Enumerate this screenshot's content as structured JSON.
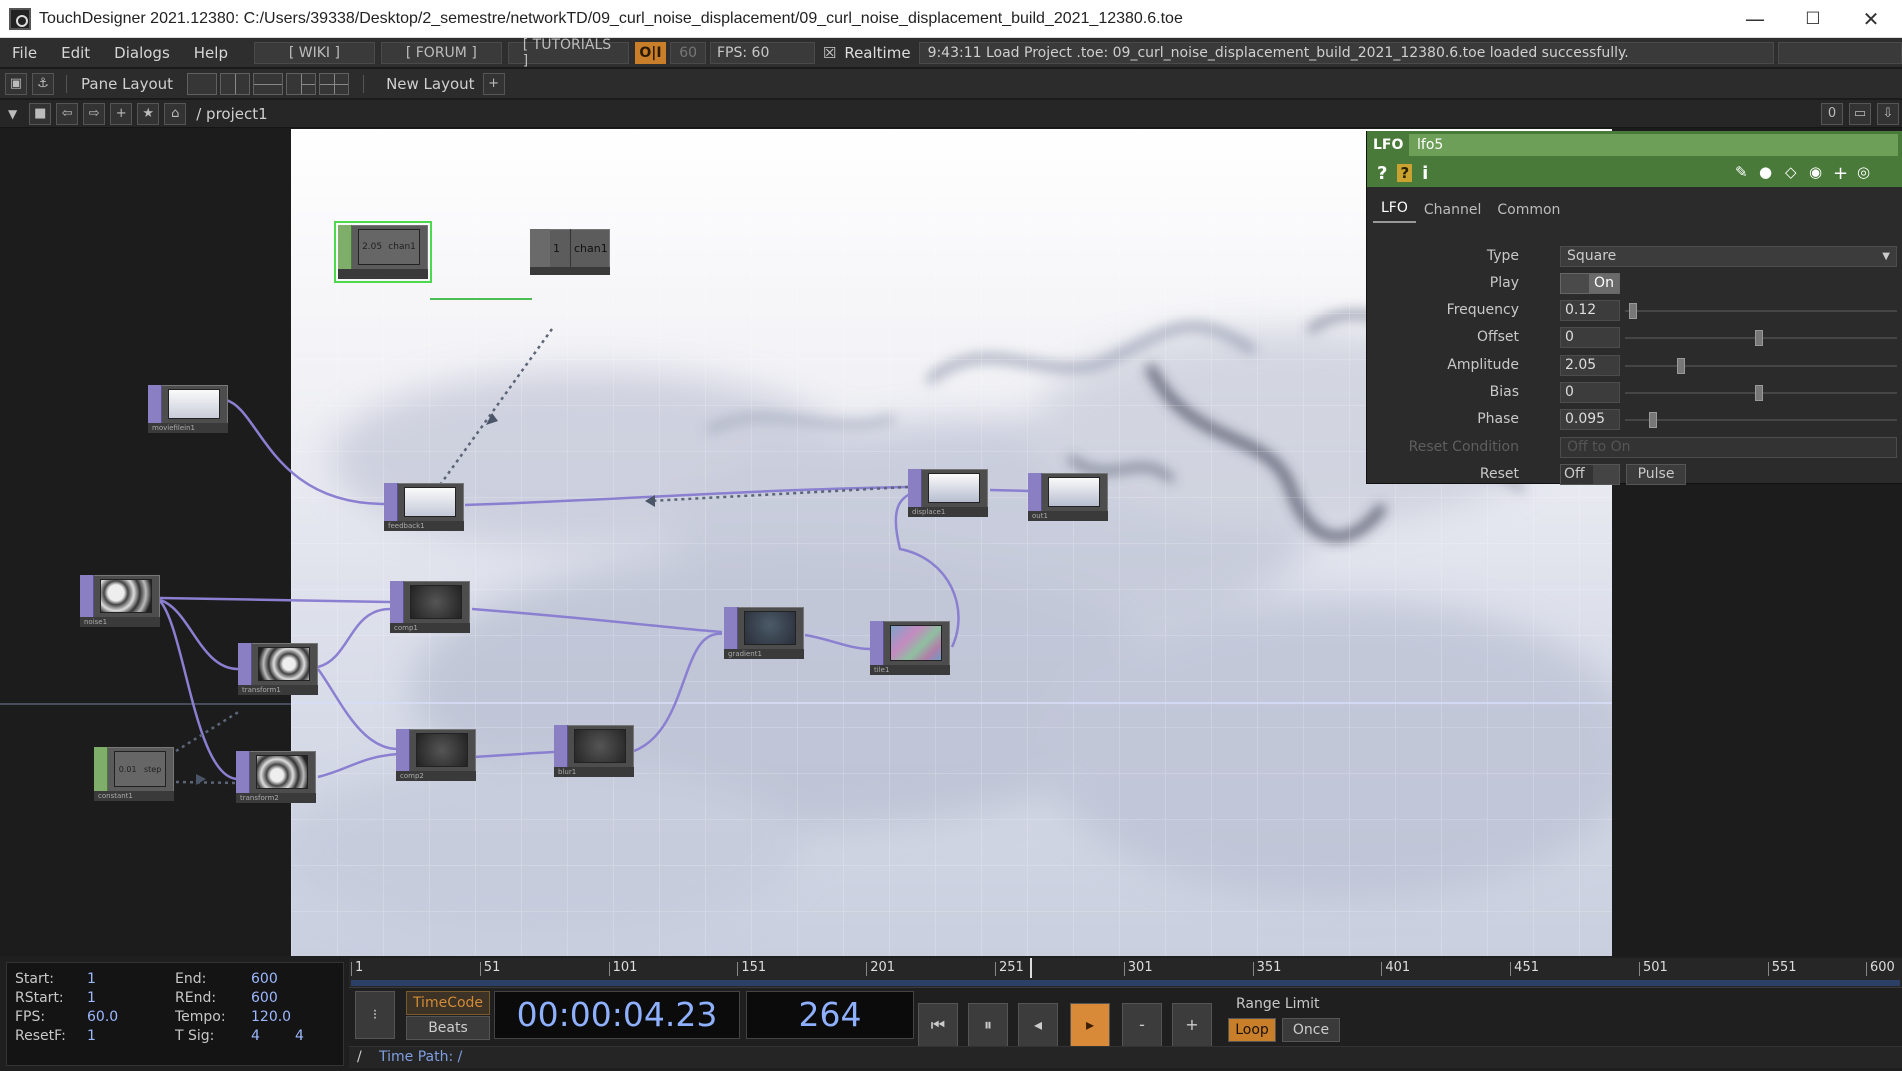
{
  "window": {
    "title": "TouchDesigner 2021.12380: C:/Users/39338/Desktop/2_semestre/networkTD/09_curl_noise_displacement/09_curl_noise_displacement_build_2021_12380.6.toe",
    "minimize": "—",
    "maximize": "☐",
    "close": "✕"
  },
  "menubar": {
    "file": "File",
    "edit": "Edit",
    "dialogs": "Dialogs",
    "help": "Help",
    "wiki": "[ WIKI ]",
    "forum": "[ FORUM ]",
    "tutorials": "[ TUTORIALS ]",
    "oi": "O|I",
    "fps_cap": "60",
    "fps_display": "FPS:  60",
    "realtime_check": "☒",
    "realtime": "Realtime",
    "status": "9:43:11 Load Project .toe: 09_curl_noise_displacement_build_2021_12380.6.toe loaded successfully."
  },
  "panebar": {
    "pane_layout": "Pane Layout",
    "new_layout": "New Layout",
    "add": "+"
  },
  "pathbar": {
    "path": "/ project1",
    "counter": "0"
  },
  "nodes": {
    "lfo_value": "2.05",
    "lfo_channel": "chan1",
    "null_value": "1",
    "null_channel": "chan1",
    "constant_value": "0.01",
    "constant_channel": "step",
    "moviefilein": "moviefilein1",
    "noise": "noise1",
    "transform1": "transform1",
    "transform2": "transform2",
    "constant": "constant1",
    "feedback": "feedback1",
    "comp1": "comp1",
    "comp2": "comp2",
    "blur": "blur1",
    "gradient": "gradient1",
    "tile": "tile1",
    "displace": "displace1",
    "out": "out1"
  },
  "param_panel": {
    "op_type": "LFO",
    "op_name": "lfo5",
    "tabs": [
      "LFO",
      "Channel",
      "Common"
    ],
    "type_label": "Type",
    "type_value": "Square",
    "play_label": "Play",
    "play_value": "On",
    "frequency_label": "Frequency",
    "frequency_value": "0.12",
    "offset_label": "Offset",
    "offset_value": "0",
    "amplitude_label": "Amplitude",
    "amplitude_value": "2.05",
    "bias_label": "Bias",
    "bias_value": "0",
    "phase_label": "Phase",
    "phase_value": "0.095",
    "reset_condition_label": "Reset Condition",
    "reset_condition_value": "Off to On",
    "reset_label": "Reset",
    "reset_value": "Off",
    "pulse": "Pulse"
  },
  "timeline": {
    "start_label": "Start:",
    "start": "1",
    "end_label": "End:",
    "end": "600",
    "rstart_label": "RStart:",
    "rstart": "1",
    "rend_label": "REnd:",
    "rend": "600",
    "fps_label": "FPS:",
    "fps": "60.0",
    "tempo_label": "Tempo:",
    "tempo": "120.0",
    "resetf_label": "ResetF:",
    "resetf": "1",
    "tsig_label": "T Sig:",
    "tsig_a": "4",
    "tsig_b": "4",
    "ticks": [
      "1",
      "51",
      "101",
      "151",
      "201",
      "251",
      "301",
      "351",
      "401",
      "451",
      "501",
      "551",
      "600"
    ],
    "current_frame_fraction": 0.44,
    "timecode_label": "TimeCode",
    "beats_label": "Beats",
    "timecode": "00:00:04.23",
    "frame": "264",
    "range_limit": "Range Limit",
    "loop": "Loop",
    "once": "Once",
    "time_path": "Time Path: /",
    "slash": "/",
    "minus": "-",
    "plus": "+"
  }
}
